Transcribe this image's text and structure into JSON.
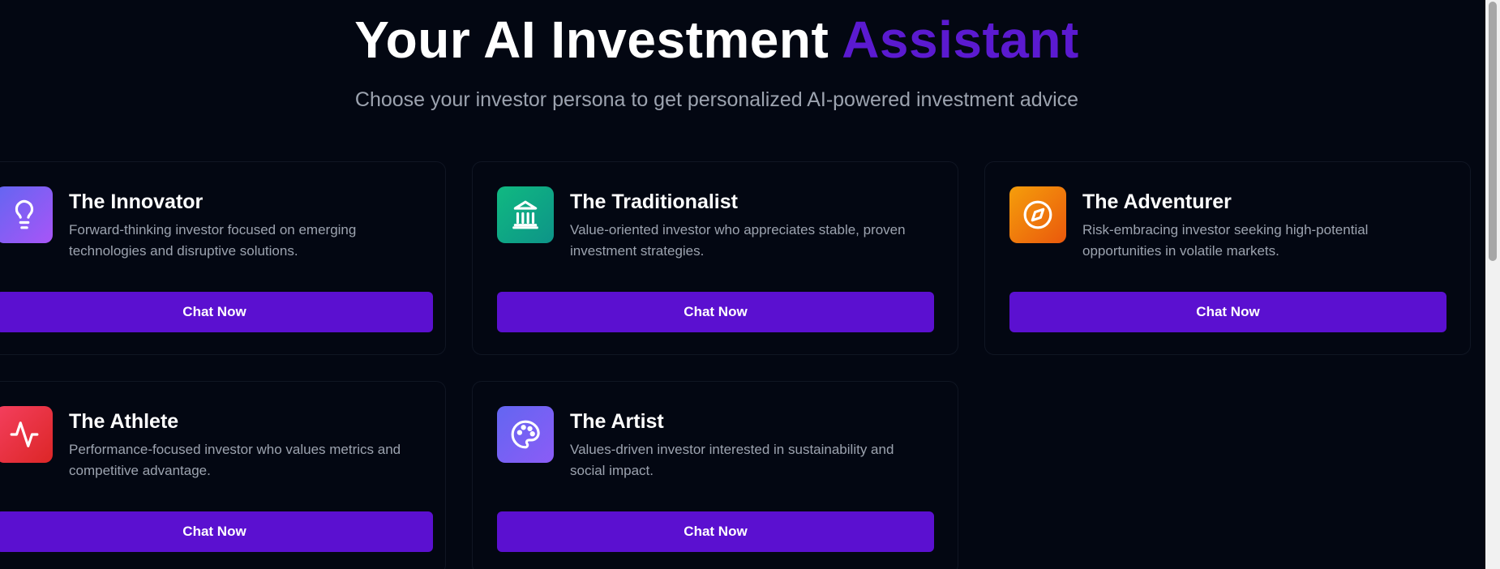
{
  "hero": {
    "title_main": "Your AI Investment",
    "title_accent": "Assistant",
    "subtitle": "Choose your investor persona to get personalized AI-powered investment advice"
  },
  "colors": {
    "background": "#030712",
    "accent": "#5b1ad0",
    "button": "#5b10d0"
  },
  "personas": [
    {
      "title": "The Innovator",
      "description": "Forward-thinking investor focused on emerging technologies and disruptive solutions.",
      "button_label": "Chat Now",
      "icon": "lightbulb-icon",
      "gradient": [
        "#6366f1",
        "#a855f7"
      ]
    },
    {
      "title": "The Traditionalist",
      "description": "Value-oriented investor who appreciates stable, proven investment strategies.",
      "button_label": "Chat Now",
      "icon": "bank-icon",
      "gradient": [
        "#10b981",
        "#0d9488"
      ]
    },
    {
      "title": "The Adventurer",
      "description": "Risk-embracing investor seeking high-potential opportunities in volatile markets.",
      "button_label": "Chat Now",
      "icon": "compass-icon",
      "gradient": [
        "#f59e0b",
        "#ea580c"
      ]
    },
    {
      "title": "The Athlete",
      "description": "Performance-focused investor who values metrics and competitive advantage.",
      "button_label": "Chat Now",
      "icon": "activity-icon",
      "gradient": [
        "#f43f5e",
        "#dc2626"
      ]
    },
    {
      "title": "The Artist",
      "description": "Values-driven investor interested in sustainability and social impact.",
      "button_label": "Chat Now",
      "icon": "palette-icon",
      "gradient": [
        "#6366f1",
        "#8b5cf6"
      ]
    }
  ]
}
